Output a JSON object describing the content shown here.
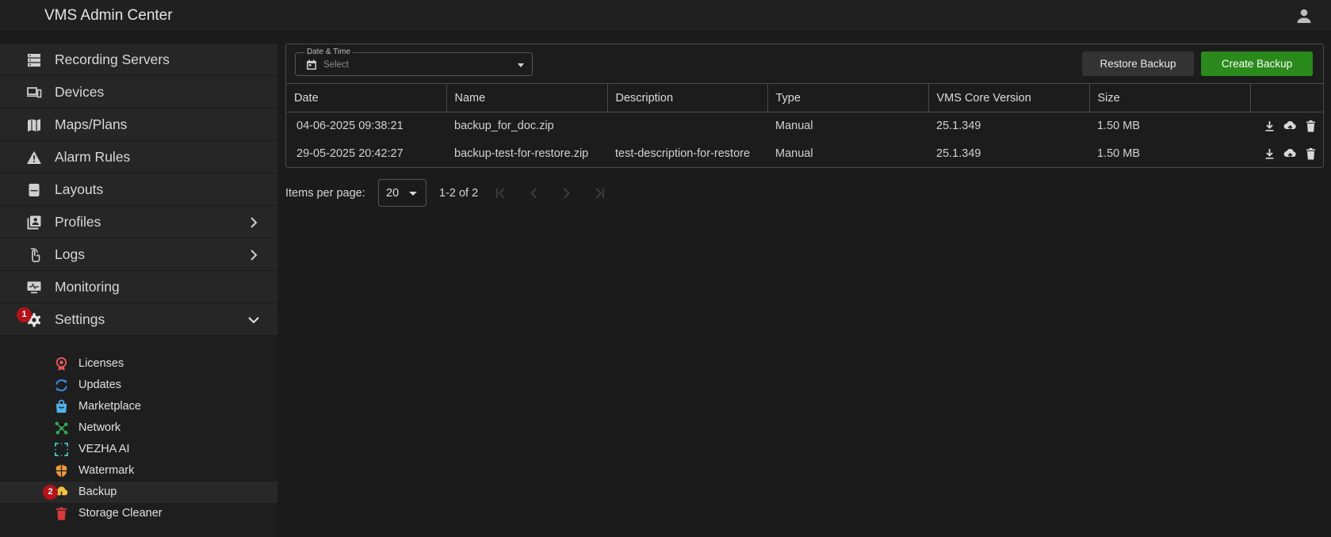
{
  "app": {
    "title": "VMS Admin Center"
  },
  "colors": {
    "accent_green": "#2a8a1b",
    "badge_red": "#b3121a",
    "background": "#1b1b1b"
  },
  "sidebar": {
    "items": [
      {
        "label": "Recording Servers",
        "icon": "server-icon"
      },
      {
        "label": "Devices",
        "icon": "devices-icon"
      },
      {
        "label": "Maps/Plans",
        "icon": "map-icon"
      },
      {
        "label": "Alarm Rules",
        "icon": "warning-icon"
      },
      {
        "label": "Layouts",
        "icon": "layouts-icon"
      },
      {
        "label": "Profiles",
        "icon": "profiles-icon",
        "expandable": true
      },
      {
        "label": "Logs",
        "icon": "logs-icon",
        "expandable": true
      },
      {
        "label": "Monitoring",
        "icon": "monitor-icon"
      },
      {
        "label": "Settings",
        "icon": "gear-icon",
        "expanded": true,
        "badge": "1"
      }
    ],
    "sub_items": [
      {
        "label": "Licenses",
        "icon": "license-icon",
        "color": "#e05757"
      },
      {
        "label": "Updates",
        "icon": "refresh-icon",
        "color": "#3a86e0"
      },
      {
        "label": "Marketplace",
        "icon": "shopping-bag-icon",
        "color": "#4fb3e8"
      },
      {
        "label": "Network",
        "icon": "network-icon",
        "color": "#35a653"
      },
      {
        "label": "VEZHA AI",
        "icon": "ai-scan-icon",
        "color": "#3fd0c4"
      },
      {
        "label": "Watermark",
        "icon": "shield-icon",
        "color": "#f29a3a"
      },
      {
        "label": "Backup",
        "icon": "cloud-download-icon",
        "color": "#f2c23a",
        "active": true,
        "badge": "2"
      },
      {
        "label": "Storage Cleaner",
        "icon": "trash-icon",
        "color": "#d63b3b"
      }
    ]
  },
  "filter": {
    "legend": "Date & Time",
    "placeholder": "Select"
  },
  "toolbar": {
    "restore_label": "Restore Backup",
    "create_label": "Create Backup"
  },
  "table": {
    "columns": [
      "Date",
      "Name",
      "Description",
      "Type",
      "VMS Core Version",
      "Size",
      ""
    ],
    "rows": [
      {
        "date": "04-06-2025 09:38:21",
        "name": "backup_for_doc.zip",
        "description": "",
        "type": "Manual",
        "version": "25.1.349",
        "size": "1.50 MB"
      },
      {
        "date": "29-05-2025 20:42:27",
        "name": "backup-test-for-restore.zip",
        "description": "test-description-for-restore",
        "type": "Manual",
        "version": "25.1.349",
        "size": "1.50 MB"
      }
    ],
    "row_actions": [
      "download-icon",
      "cloud-upload-icon",
      "delete-icon"
    ]
  },
  "pagination": {
    "items_per_page_label": "Items per page:",
    "page_size": "20",
    "range": "1-2 of 2"
  }
}
